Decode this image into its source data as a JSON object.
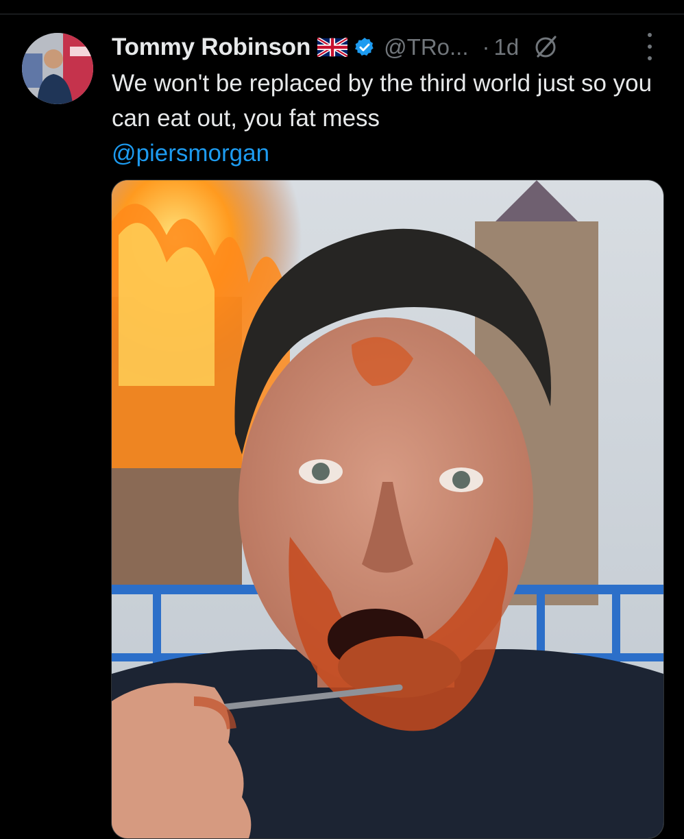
{
  "tweet": {
    "author_name": "Tommy Robinson",
    "handle": "@TRo...",
    "separator": "·",
    "timestamp": "1d",
    "text": "We won't be replaced by the third world just so you can eat out, you fat mess",
    "mention": "@piersmorgan"
  },
  "icons": {
    "flag": "uk-flag-icon",
    "verified": "verified-badge-icon",
    "grok": "grok-icon",
    "more": "more-options-icon"
  },
  "colors": {
    "background": "#000000",
    "text_primary": "#e7e9ea",
    "text_secondary": "#71767b",
    "link": "#1d9bf0",
    "verified_badge": "#1d9bf0"
  },
  "media": {
    "type": "image",
    "alt_visible": ""
  }
}
